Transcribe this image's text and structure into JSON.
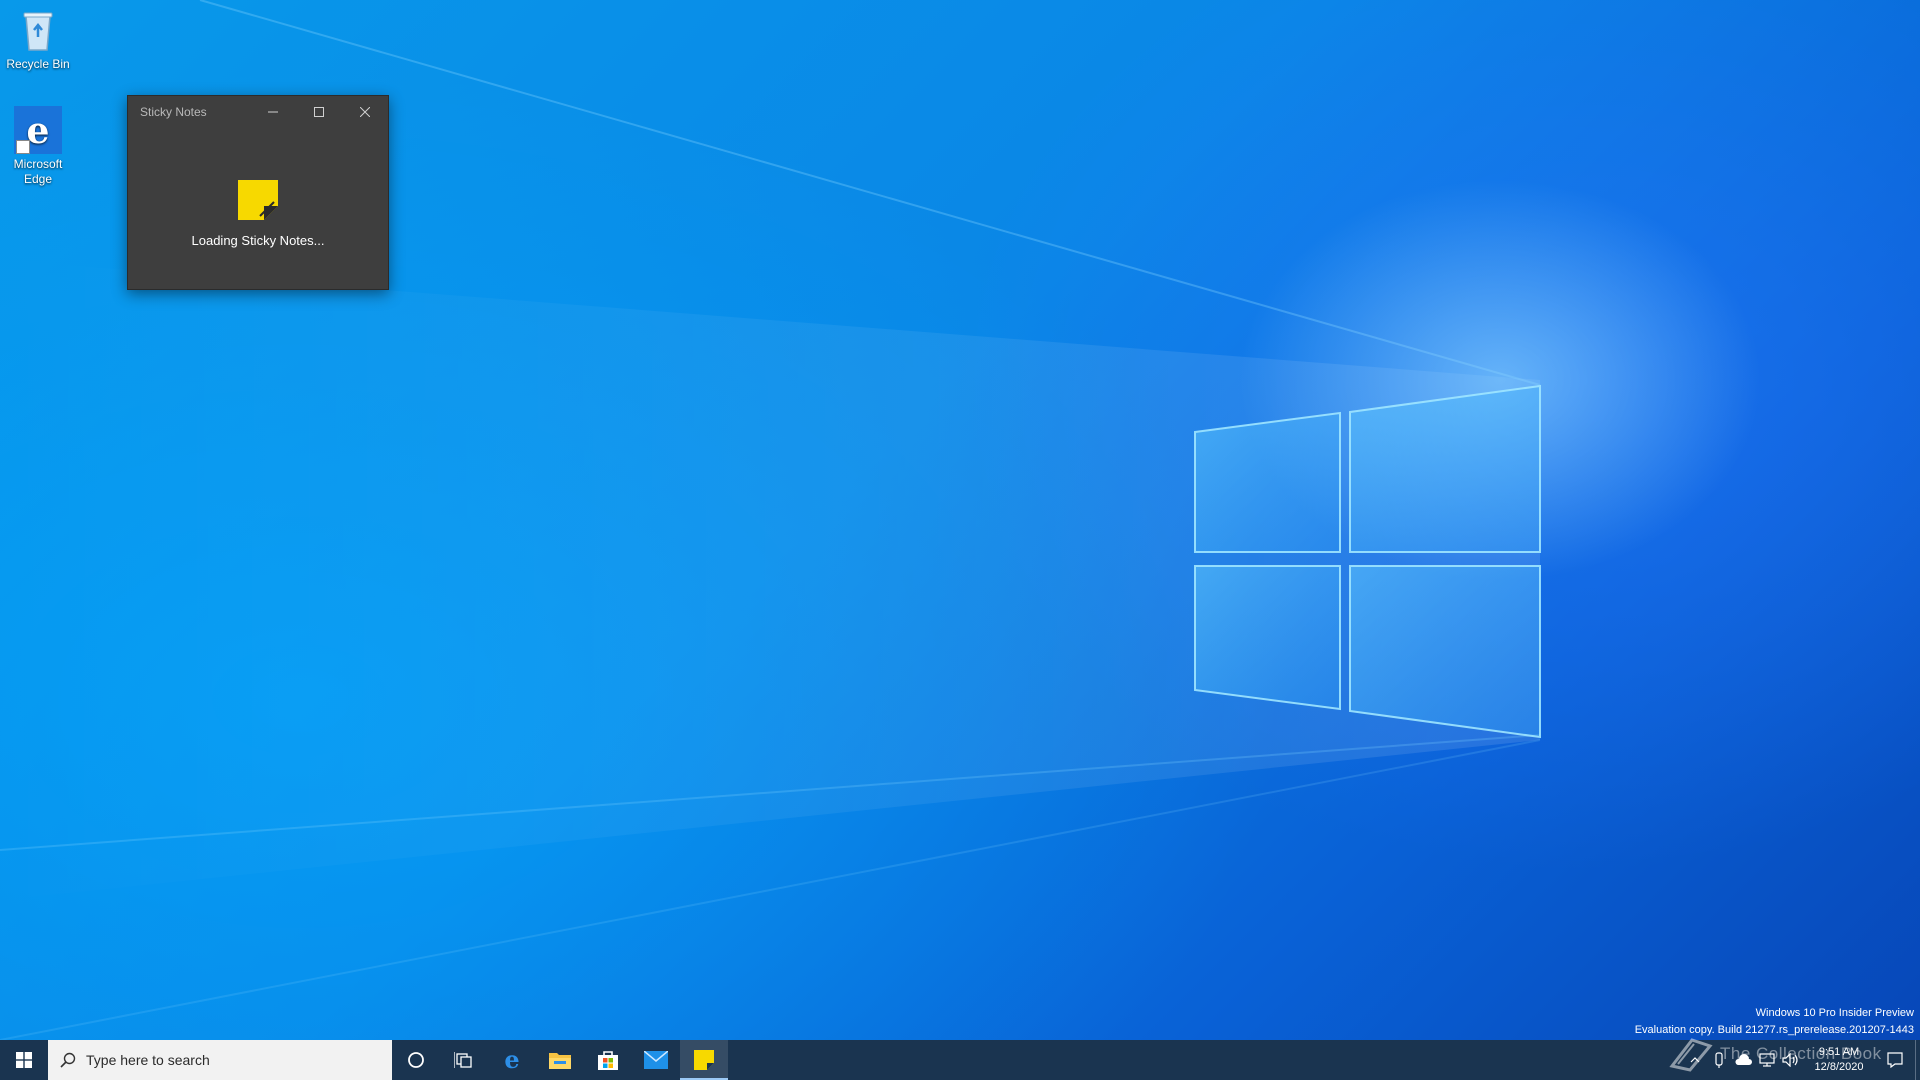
{
  "desktop": {
    "icons": [
      {
        "label": "Recycle Bin",
        "icon": "recycle-bin-icon"
      },
      {
        "label": "Microsoft Edge",
        "icon": "edge-icon"
      }
    ]
  },
  "sticky_notes": {
    "title": "Sticky Notes",
    "loading_text": "Loading Sticky Notes...",
    "accent": "#f7d900"
  },
  "watermark": {
    "line1": "Windows 10 Pro Insider Preview",
    "line2": "Evaluation copy. Build 21277.rs_prerelease.201207-1443"
  },
  "overlay_watermark": "The Collection Book",
  "taskbar": {
    "search_placeholder": "Type here to search",
    "pinned": [
      {
        "name": "cortana",
        "icon": "cortana-icon"
      },
      {
        "name": "task-view",
        "icon": "task-view-icon"
      },
      {
        "name": "edge",
        "icon": "edge-icon"
      },
      {
        "name": "file-explorer",
        "icon": "folder-icon"
      },
      {
        "name": "store",
        "icon": "store-icon"
      },
      {
        "name": "mail",
        "icon": "mail-icon"
      },
      {
        "name": "sticky-notes",
        "icon": "sticky-notes-icon",
        "active": true
      }
    ],
    "clock": {
      "time": "9:51 AM",
      "date": "12/8/2020"
    }
  }
}
